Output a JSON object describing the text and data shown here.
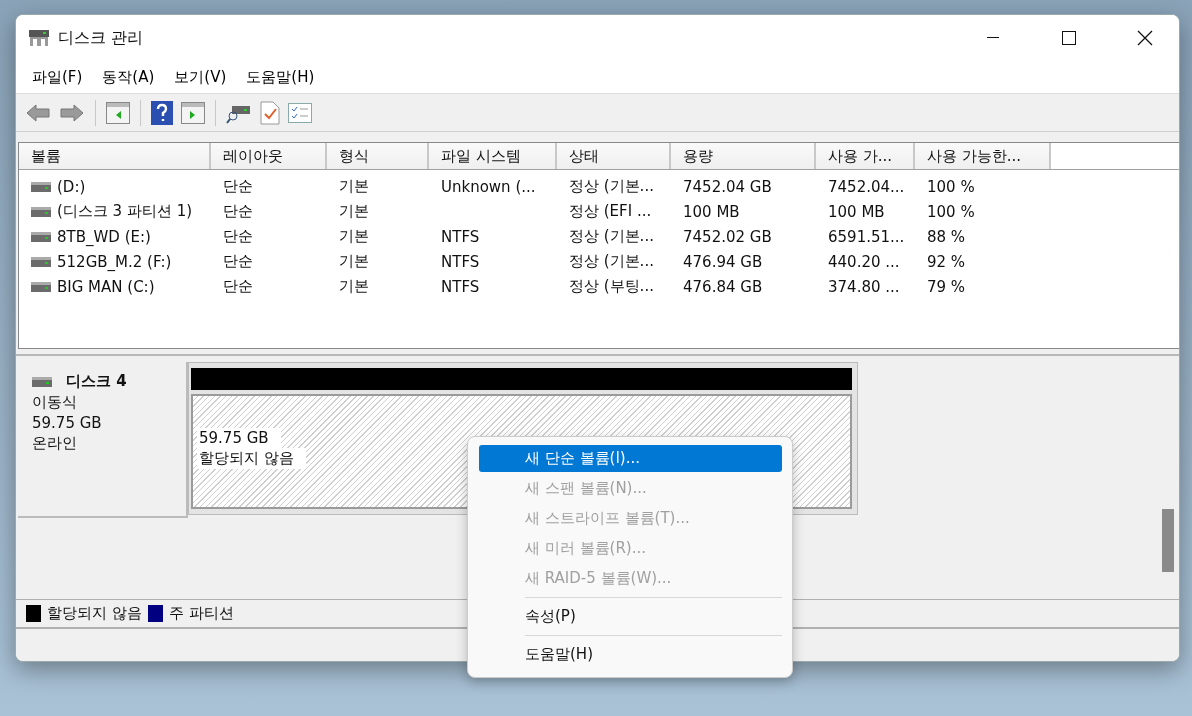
{
  "window": {
    "title": "디스크 관리"
  },
  "menu": [
    "파일(F)",
    "동작(A)",
    "보기(V)",
    "도움말(H)"
  ],
  "table": {
    "columns": [
      "볼륨",
      "레이아웃",
      "형식",
      "파일 시스템",
      "상태",
      "용량",
      "사용 가...",
      "사용 가능한..."
    ],
    "rows": [
      [
        "(D:)",
        "단순",
        "기본",
        "Unknown (...",
        "정상 (기본...",
        "7452.04 GB",
        "7452.04...",
        "100 %"
      ],
      [
        "(디스크 3 파티션 1)",
        "단순",
        "기본",
        "",
        "정상 (EFI ...",
        "100 MB",
        "100 MB",
        "100 %"
      ],
      [
        "8TB_WD (E:)",
        "단순",
        "기본",
        "NTFS",
        "정상 (기본...",
        "7452.02 GB",
        "6591.51...",
        "88 %"
      ],
      [
        "512GB_M.2 (F:)",
        "단순",
        "기본",
        "NTFS",
        "정상 (기본...",
        "476.94 GB",
        "440.20 ...",
        "92 %"
      ],
      [
        "BIG MAN (C:)",
        "단순",
        "기본",
        "NTFS",
        "정상 (부팅...",
        "476.84 GB",
        "374.80 ...",
        "79 %"
      ]
    ]
  },
  "disk": {
    "name": "디스크 4",
    "type": "이동식",
    "size": "59.75 GB",
    "status": "온라인",
    "partition": {
      "size": "59.75 GB",
      "label": "할당되지 않음"
    }
  },
  "legend": [
    {
      "label": "할당되지 않음",
      "color": "#000000"
    },
    {
      "label": "주 파티션",
      "color": "#000080"
    }
  ],
  "context_menu": [
    {
      "kind": "item",
      "label": "새 단순 볼륨(I)...",
      "selected": true,
      "disabled": false
    },
    {
      "kind": "item",
      "label": "새 스팬 볼륨(N)...",
      "selected": false,
      "disabled": true
    },
    {
      "kind": "item",
      "label": "새 스트라이프 볼륨(T)...",
      "selected": false,
      "disabled": true
    },
    {
      "kind": "item",
      "label": "새 미러 볼륨(R)...",
      "selected": false,
      "disabled": true
    },
    {
      "kind": "item",
      "label": "새 RAID-5 볼륨(W)...",
      "selected": false,
      "disabled": true
    },
    {
      "kind": "separator"
    },
    {
      "kind": "item",
      "label": "속성(P)",
      "selected": false,
      "disabled": false
    },
    {
      "kind": "separator"
    },
    {
      "kind": "item",
      "label": "도움말(H)",
      "selected": false,
      "disabled": false
    }
  ]
}
